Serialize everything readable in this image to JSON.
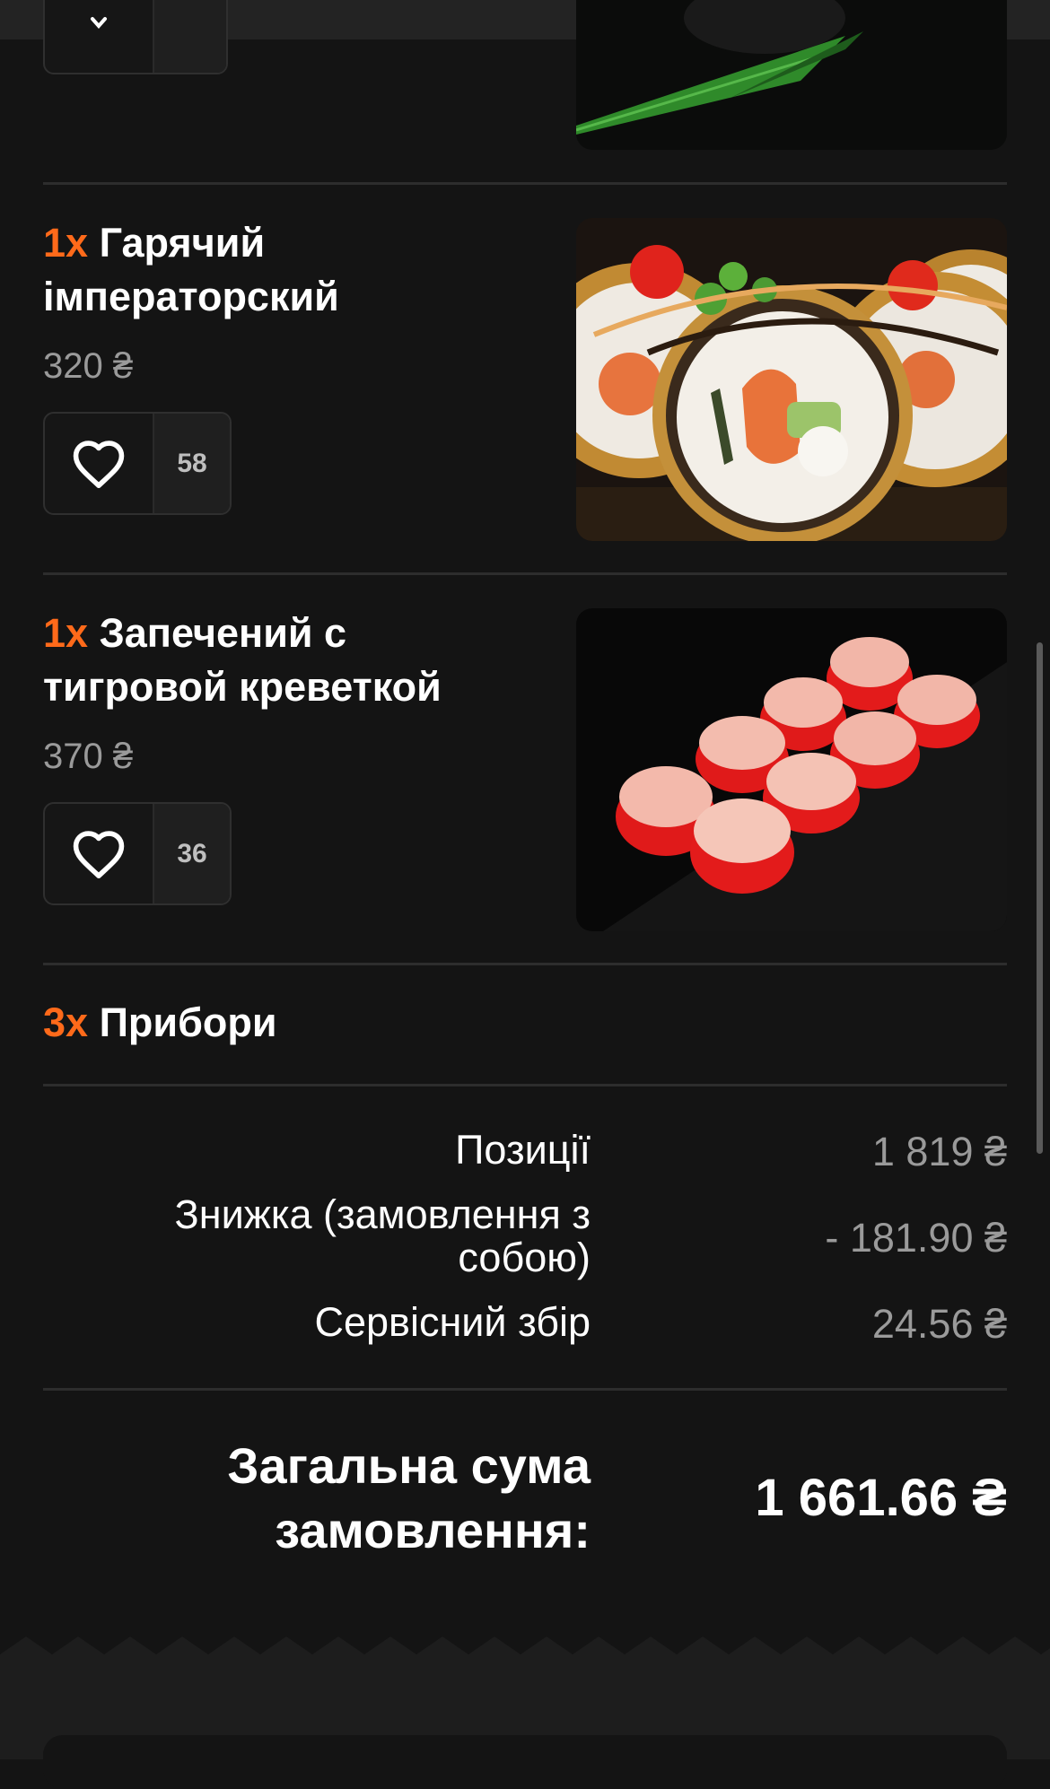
{
  "items": [
    {
      "qty": "1x",
      "name_line1": "Гарячий",
      "name_line2": "імператорский",
      "price": "320 ₴",
      "likes": "58"
    },
    {
      "qty": "1x",
      "name_line1": "Запечений с",
      "name_line2": "тигровой креветкой",
      "price": "370 ₴",
      "likes": "36"
    }
  ],
  "extras": {
    "qty": "3x",
    "name": "Прибори"
  },
  "summary": {
    "positions_label": "Позиції",
    "positions_value": "1 819 ₴",
    "discount_label_line1": "Знижка (замовлення з",
    "discount_label_line2": "собою)",
    "discount_value": "- 181.90 ₴",
    "service_label": "Сервісний збір",
    "service_value": "24.56 ₴"
  },
  "total": {
    "label_line1": "Загальна сума",
    "label_line2": "замовлення:",
    "value": "1 661.66 ₴"
  },
  "colors": {
    "accent": "#ff6a1a",
    "background": "#141414",
    "muted": "#9a9a9a"
  },
  "icons": [
    "heart-icon",
    "chevron-down-icon"
  ]
}
